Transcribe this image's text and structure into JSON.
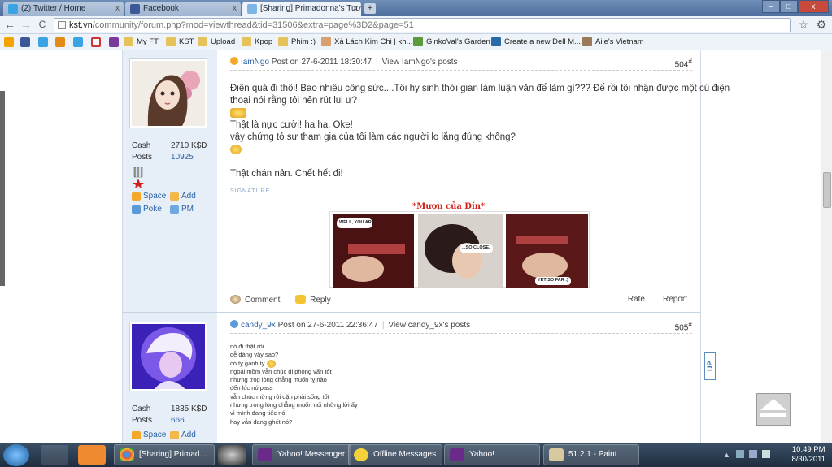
{
  "browser": {
    "tabs": [
      {
        "label": "(2) Twitter / Home",
        "active": false
      },
      {
        "label": "Facebook",
        "active": false
      },
      {
        "label": "[Sharing] Primadonna's Tuơ",
        "active": true
      }
    ],
    "new_tab": "+",
    "window_buttons": {
      "minimize": "–",
      "maximize": "□",
      "close": "x"
    },
    "back": "←",
    "forward": "→",
    "reload": "C",
    "url_host": "kst.vn",
    "url_path": "/community/forum.php?mod=viewthread&tid=31506&extra=page%3D2&page=51",
    "star": "☆",
    "wrench": "⚙",
    "bookmarks": [
      "My FT",
      "KST",
      "Upload",
      "Kpop",
      "Phim :)",
      "Xà Lách Kim Chi | kh...",
      "GinkoVal's Garden",
      "Create a new Dell M...",
      "Aile's Vietnam"
    ]
  },
  "post1": {
    "username": "IamNgo",
    "meta": "Post on 27-6-2011 18:30:47",
    "view_link": "View IamNgo's posts",
    "number": "504",
    "sup": "#",
    "cash_label": "Cash",
    "cash_value": "2710 K$D",
    "posts_label": "Posts",
    "posts_value": "10925",
    "actions": [
      "Space",
      "Add",
      "Poke",
      "PM"
    ],
    "lines": [
      "Điên quá đi thôi! Bao nhiêu công sức....Tôi hy sinh thời gian làm luận văn để làm gì??? Để rồi tôi nhận được một cú điện",
      "thoại nói rằng tôi nên rút lui ư?",
      "Thật là nực cười! ha ha. Oke!",
      "vậy chứng tỏ sự tham gia của tôi làm các người lo lắng đúng không?",
      "Thật chán nản. Chết hết đi!"
    ],
    "signature_label": "SIGNATURE",
    "sig_title": "*Mượn của Dín*",
    "comic": [
      "WELL, YOU ARE",
      "...SO CLOSE,",
      "YET SO FAR :)"
    ],
    "comment": "Comment",
    "reply": "Reply",
    "rate": "Rate",
    "report": "Report"
  },
  "post2": {
    "username": "candy_9x",
    "meta": "Post on 27-6-2011 22:36:47",
    "view_link": "View candy_9x's posts",
    "number": "505",
    "sup": "#",
    "cash_label": "Cash",
    "cash_value": "1835 K$D",
    "posts_label": "Posts",
    "posts_value": "666",
    "actions": [
      "Space",
      "Add"
    ],
    "lines": [
      "nó đi thật rồi",
      "dễ dàng vậy sao?",
      "có tỵ ganh tỵ",
      "ngoài mồm vẫn chúc đi phỏng vấn tốt",
      "nhưng trog lòng chẳng muốn tỵ nào",
      "đến lúc nó pass",
      "vẫn chúc mừng rồi dặn phải sống tốt",
      "nhưng trong lòng chẳng muốn nói những lời ấy",
      "vì mình đang tiếc nó",
      "hay vẫn đang ghét nó?"
    ]
  },
  "up_tab": "UP",
  "taskbar": {
    "items": [
      "[Sharing] Primad...",
      "Yahoo! Messenger",
      "Offline Messages",
      "Yahoo!",
      "51.2.1 - Paint"
    ],
    "time": "10:49 PM",
    "date": "8/30/2011"
  },
  "colors": {
    "link": "#2b62a8",
    "sidebar": "#e6eef7",
    "sig_title": "#d0201a"
  }
}
